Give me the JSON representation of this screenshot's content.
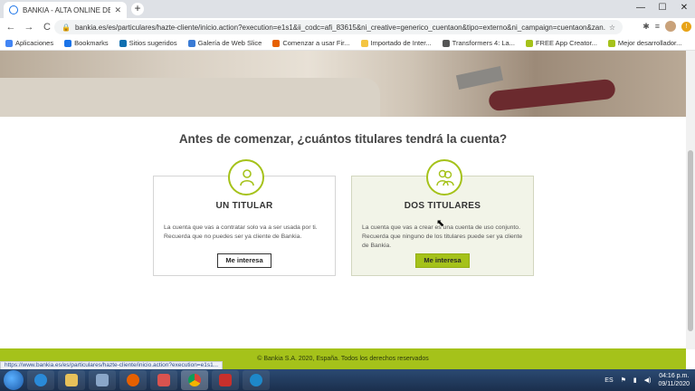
{
  "browser": {
    "tab_title": "BANKIA - ALTA ONLINE DE CLIE",
    "tab_close": "✕",
    "new_tab": "+",
    "url": "bankia.es/es/particulares/hazte-cliente/inicio.action?execution=e1s1&ii_codc=afi_83615&ni_creative=generico_cuentaon&tipo=externo&ni_campaign=cuentaon&zan...",
    "back": "←",
    "forward": "→",
    "reload": "C",
    "lock": "🔒",
    "star": "☆",
    "min": "—",
    "max": "☐",
    "close": "✕"
  },
  "bookmarks": [
    {
      "label": "Aplicaciones",
      "color": "#4285f4"
    },
    {
      "label": "Bookmarks",
      "color": "#1a73e8"
    },
    {
      "label": "Sitios sugeridos",
      "color": "#0f6fb0"
    },
    {
      "label": "Galería de Web Slice",
      "color": "#3a7bd5"
    },
    {
      "label": "Comenzar a usar Fir...",
      "color": "#e66000"
    },
    {
      "label": "Importado de Inter...",
      "color": "#f4c542"
    },
    {
      "label": "Transformers 4: La...",
      "color": "#555555"
    },
    {
      "label": "FREE App Creator...",
      "color": "#a5c21a"
    },
    {
      "label": "Mejor desarrollador...",
      "color": "#a5c21a"
    }
  ],
  "page": {
    "question": "Antes de comenzar, ¿cuántos titulares tendrá la cuenta?",
    "cards": [
      {
        "title": "UN TITULAR",
        "text": "La cuenta que vas a contratar solo va a ser usada por ti. Recuerda que no puedes ser ya cliente de Bankia.",
        "button": "Me interesa"
      },
      {
        "title": "DOS TITULARES",
        "text": "La cuenta que vas a crear es una cuenta de uso conjunto. Recuerda que ninguno de los titulares puede ser ya cliente de Bankia.",
        "button": "Me interesa"
      }
    ],
    "footer": "© Bankia S.A. 2020, España. Todos los derechos reservados",
    "status_url": "https://www.bankia.es/es/particulares/hazte-cliente/inicio.action?execution=e1s1..."
  },
  "taskbar": {
    "language": "ES",
    "time": "04:16 p.m.",
    "date": "09/11/2020"
  },
  "colors": {
    "accent": "#a5c21a",
    "selected_card": "#f2f4e8"
  }
}
